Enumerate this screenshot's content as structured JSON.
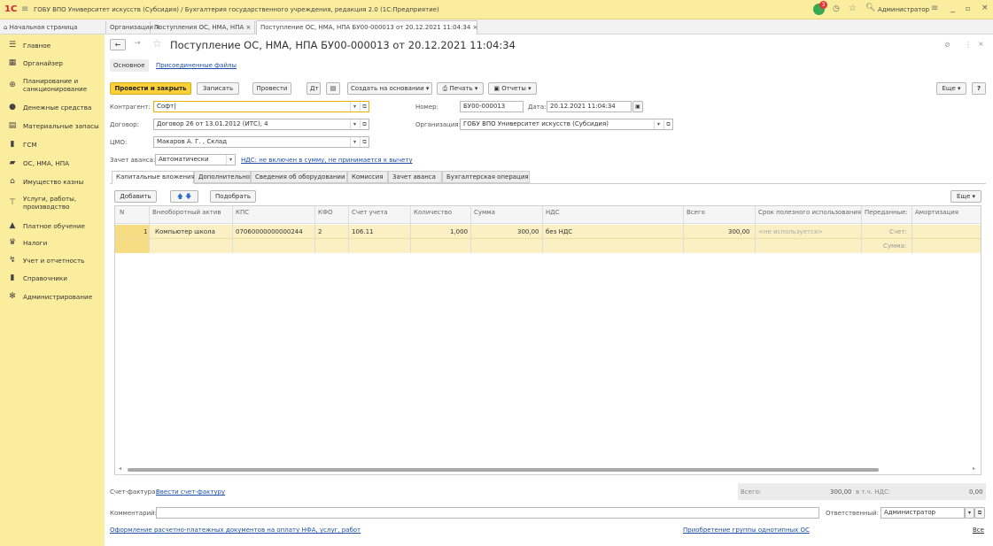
{
  "titlebar": {
    "logo": "1С",
    "title": "ГОБУ ВПО Университет искусств (Субсидия) / Бухгалтерия государственного учреждения, редакция 2.0  (1С:Предприятие)",
    "user": "Администратор",
    "notify_count": "3"
  },
  "window_tabs": [
    {
      "label": "Начальная страница"
    },
    {
      "label": "Организации ×"
    },
    {
      "label": "Поступления ОС, НМА, НПА ×"
    },
    {
      "label": "Поступление ОС, НМА, НПА БУ00-000013 от 20.12.2021 11:04:34 ×"
    }
  ],
  "sidebar": {
    "items": [
      {
        "label": "Главное",
        "icon": "menu-icon"
      },
      {
        "label": "Органайзер",
        "icon": "calendar-icon"
      },
      {
        "label": "Планирование и санкционирование",
        "icon": "planning-icon"
      },
      {
        "label": "Денежные средства",
        "icon": "money-icon"
      },
      {
        "label": "Материальные запасы",
        "icon": "inventory-icon"
      },
      {
        "label": "ГСМ",
        "icon": "fuel-icon"
      },
      {
        "label": "ОС, НМА, НПА",
        "icon": "truck-icon"
      },
      {
        "label": "Имущество казны",
        "icon": "building-icon"
      },
      {
        "label": "Услуги, работы, производство",
        "icon": "tools-icon"
      },
      {
        "label": "Платное обучение",
        "icon": "graduation-icon"
      },
      {
        "label": "Налоги",
        "icon": "tax-icon"
      },
      {
        "label": "Учет и отчетность",
        "icon": "report-icon"
      },
      {
        "label": "Справочники",
        "icon": "book-icon"
      },
      {
        "label": "Администрирование",
        "icon": "gear-icon"
      }
    ]
  },
  "doc": {
    "title": "Поступление ОС, НМА, НПА БУ00-000013 от 20.12.2021 11:04:34",
    "subtabs": {
      "main": "Основное",
      "files": "Присоединенные файлы"
    },
    "toolbar": {
      "post_close": "Провести и закрыть",
      "save": "Записать",
      "post": "Провести",
      "create_based": "Создать на основании",
      "print": "Печать",
      "reports": "Отчеты",
      "more": "Еще",
      "help": "?"
    },
    "fields": {
      "counterparty_label": "Контрагент:",
      "counterparty_value": "Софт",
      "number_label": "Номер:",
      "number_value": "БУ00-000013",
      "date_label": "Дата:",
      "date_value": "20.12.2021 11:04:34",
      "contract_label": "Договор:",
      "contract_value": "Договор 26 от 13.01.2012 (ИТС), 4",
      "org_label": "Организация:",
      "org_value": "ГОБУ ВПО Университет искусств (Субсидия)",
      "cmo_label": "ЦМО:",
      "cmo_value": "Макаров А. Г. , Склад",
      "advance_label": "Зачет аванса:",
      "advance_value": "Автоматически",
      "vat_link": "НДС: не включен в сумму, не принимается к вычету"
    },
    "tabs": [
      "Капитальные вложения",
      "Дополнительно",
      "Сведения об оборудовании",
      "Комиссия",
      "Зачет аванса",
      "Бухгалтерская операция"
    ],
    "table_toolbar": {
      "add": "Добавить",
      "pick": "Подобрать",
      "more": "Еще"
    },
    "columns": [
      "N",
      "Внеоборотный актив",
      "КПС",
      "КФО",
      "Счет учета",
      "Количество",
      "Сумма",
      "НДС",
      "Всего",
      "Срок полезного использования",
      "Переданные:",
      "Амортизация"
    ],
    "rows": [
      {
        "n": "1",
        "asset": "Компьютер школа",
        "kps": "07060000000000244",
        "kfo": "2",
        "account": "106.11",
        "qty": "1,000",
        "sum": "300,00",
        "vat": "без НДС",
        "total": "300,00",
        "life": "<не используется>",
        "transferred_account": "Счет:",
        "transferred_sum": "Сумма:"
      }
    ],
    "footer": {
      "invoice_label": "Счет-фактура:",
      "invoice_link": "Ввести счет-фактуру",
      "total_label": "Всего:",
      "total_value": "300,00",
      "vat_label": "в т.ч. НДС:",
      "vat_value": "0,00",
      "comment_label": "Комментарий:",
      "responsible_label": "Ответственный:",
      "responsible_value": "Администратор",
      "link_left": "Оформление расчетно-платежных документов на оплату НФА, услуг, работ",
      "link_right": "Приобретение группы однотипных ОС",
      "link_all": "Все"
    }
  }
}
